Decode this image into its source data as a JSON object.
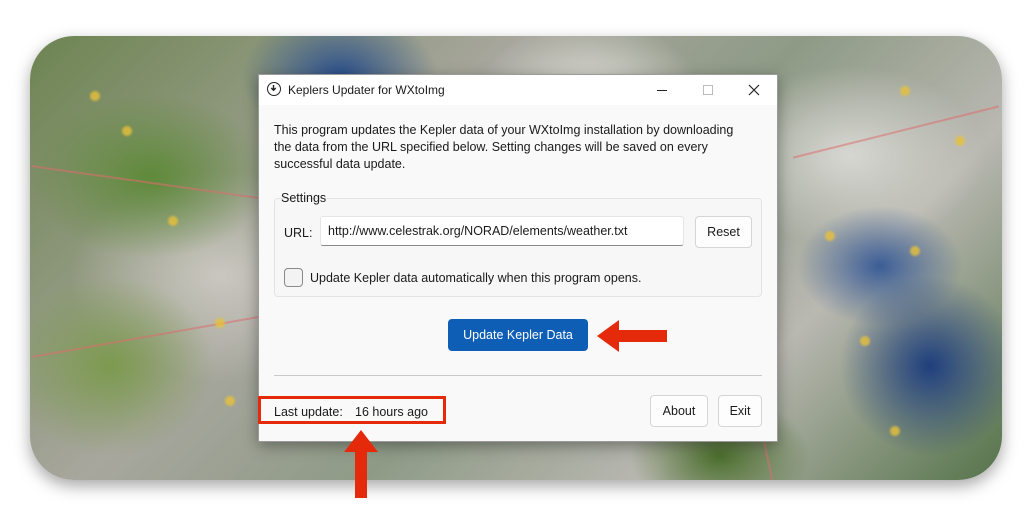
{
  "window": {
    "title": "Keplers Updater for WXtoImg",
    "description": "This program updates the Kepler data of your WXtoImg installation by downloading the data from  the URL specified below. Setting changes will be saved on every successful data update."
  },
  "settings": {
    "group_label": "Settings",
    "url_label": "URL:",
    "url_value": "http://www.celestrak.org/NORAD/elements/weather.txt",
    "reset_label": "Reset",
    "auto_update_label": "Update Kepler data automatically when this program opens.",
    "auto_update_checked": false
  },
  "actions": {
    "update_label": "Update Kepler Data",
    "about_label": "About",
    "exit_label": "Exit"
  },
  "status": {
    "last_update_label": "Last update:",
    "last_update_value": "16 hours ago"
  },
  "colors": {
    "accent": "#0f5eb5",
    "annotation": "#e52a0c"
  },
  "icons": [
    "download-circle-icon",
    "minimize-icon",
    "maximize-icon",
    "close-icon",
    "arrow-left-icon",
    "arrow-up-icon"
  ]
}
